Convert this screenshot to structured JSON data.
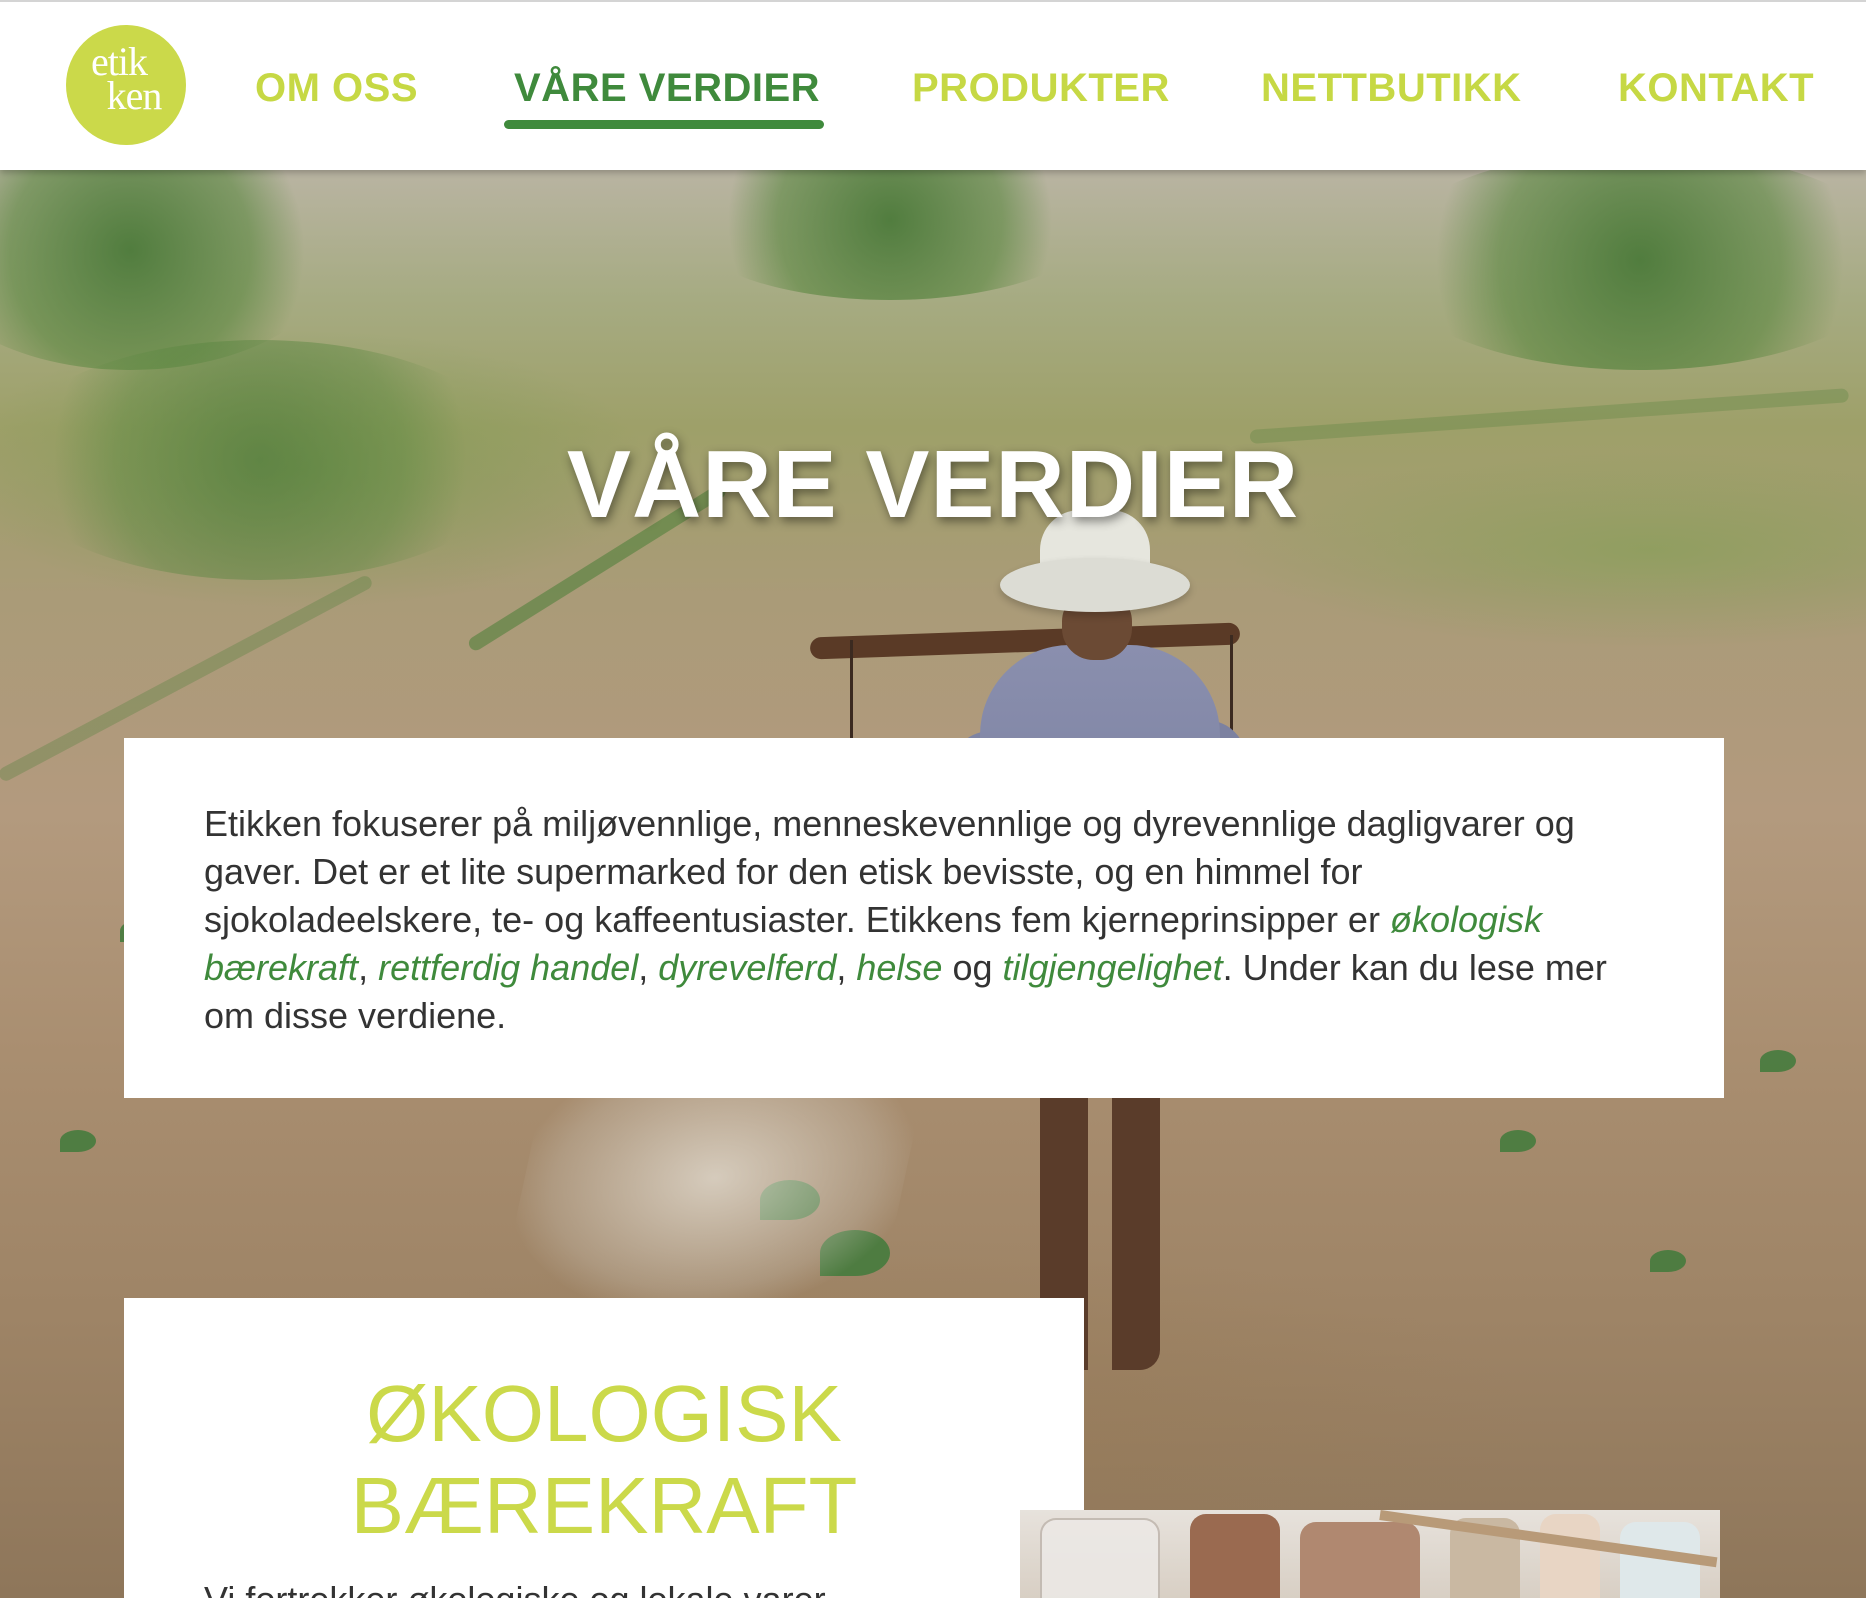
{
  "logo": {
    "line1": "etik",
    "line2": "ken"
  },
  "nav": {
    "items": [
      {
        "label": "OM OSS",
        "active": false
      },
      {
        "label": "VÅRE VERDIER",
        "active": true
      },
      {
        "label": "PRODUKTER",
        "active": false
      },
      {
        "label": "NETTBUTIKK",
        "active": false
      },
      {
        "label": "KONTAKT",
        "active": false
      }
    ]
  },
  "hero": {
    "title": "VÅRE VERDIER"
  },
  "intro": {
    "text_before": "Etikken fokuserer på miljøvennlige, menneskevennlige og dyrevennlige dagligvarer og gaver. Det er et lite supermarked for den etisk bevisste, og en himmel for sjokoladeelskere, te- og kaffeentusiaster. Etikkens fem kjerneprinsipper er ",
    "links": [
      "økologisk bærekraft",
      "rettferdig handel",
      "dyrevelferd",
      "helse",
      "tilgjengelighet"
    ],
    "sep_comma": ", ",
    "sep_and": " og ",
    "text_after": ". Under kan du lese mer om disse verdiene."
  },
  "section": {
    "title_line1": "ØKOLOGISK",
    "title_line2": "BÆREKRAFT",
    "body_peek": "Vi fortrekker økologiske og lokale varer"
  },
  "colors": {
    "brand_lime": "#cbd94a",
    "nav_inactive": "#c6d844",
    "nav_active": "#3f8a3c",
    "link_green": "#3f8a3c",
    "body_text": "#333333"
  }
}
